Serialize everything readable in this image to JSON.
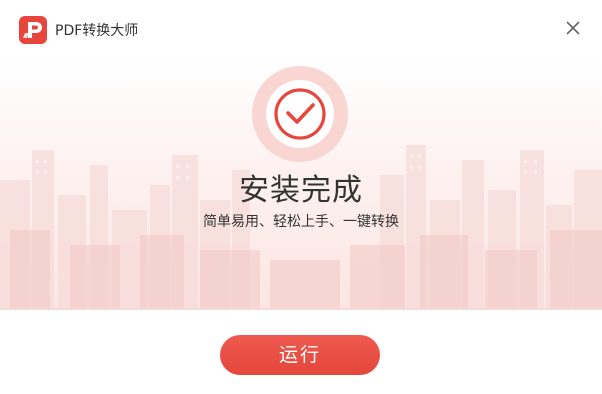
{
  "window": {
    "title": "PDF转换大师",
    "logo_letter": "P",
    "close_icon": "close-icon"
  },
  "status": {
    "headline": "安装完成",
    "subline": "简单易用、轻松上手、一键转换",
    "icon": "check-circle-icon"
  },
  "actions": {
    "run_label": "运行"
  },
  "colors": {
    "accent": "#e8453c",
    "badge_ring": "#f9d6d2",
    "text": "#333333",
    "background": "#ffffff"
  }
}
